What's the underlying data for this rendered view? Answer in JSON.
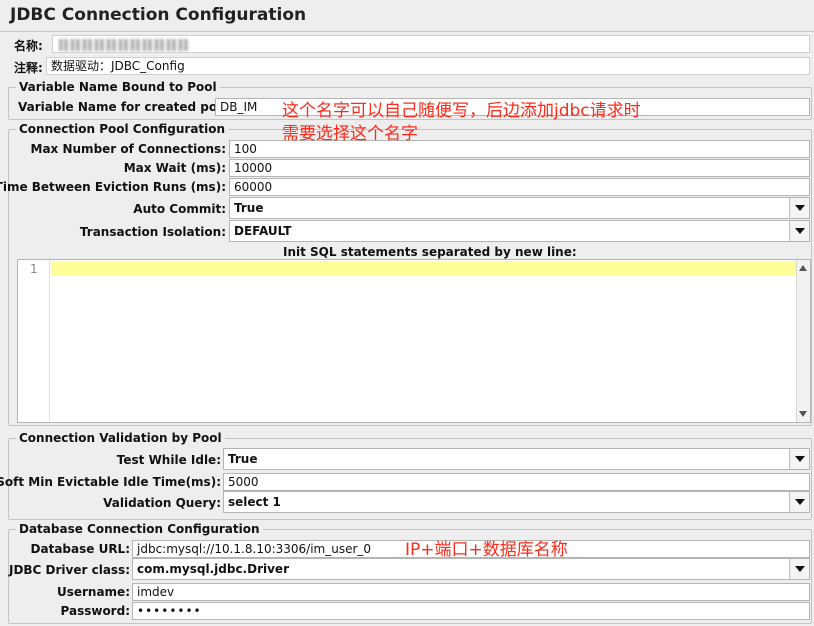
{
  "title": "JDBC Connection Configuration",
  "name_label": "名称:",
  "comment_label": "注释:",
  "comment_value": "数据驱动：JDBC_Config",
  "variable_group": {
    "legend": "Variable Name Bound to Pool",
    "label": "Variable Name for created pool:",
    "value": "DB_IM"
  },
  "annotation_1": {
    "line1": "这个名字可以自己随便写，后边添加jdbc请求时",
    "line2": "需要选择这个名字"
  },
  "pool_group": {
    "legend": "Connection Pool Configuration",
    "max_connections_label": "Max Number of Connections:",
    "max_connections_value": "100",
    "max_wait_label": "Max Wait (ms):",
    "max_wait_value": "10000",
    "eviction_label": "Time Between Eviction Runs (ms):",
    "eviction_value": "60000",
    "auto_commit_label": "Auto Commit:",
    "auto_commit_value": "True",
    "isolation_label": "Transaction Isolation:",
    "isolation_value": "DEFAULT",
    "init_sql_label": "Init SQL statements separated by new line:",
    "init_sql_line_number": "1"
  },
  "validation_group": {
    "legend": "Connection Validation by Pool",
    "test_idle_label": "Test While Idle:",
    "test_idle_value": "True",
    "soft_min_label": "Soft Min Evictable Idle Time(ms):",
    "soft_min_value": "5000",
    "query_label": "Validation Query:",
    "query_value": "select 1"
  },
  "db_group": {
    "legend": "Database Connection Configuration",
    "url_label": "Database URL:",
    "url_value": "jdbc:mysql://10.1.8.10:3306/im_user_0",
    "driver_label": "JDBC Driver class:",
    "driver_value": "com.mysql.jdbc.Driver",
    "username_label": "Username:",
    "username_value": "imdev",
    "password_label": "Password:",
    "password_value": "••••••••"
  },
  "annotation_2": "IP+端口+数据库名称",
  "colors": {
    "annotation": "#ff2a1a",
    "highlight_line": "#ffff99",
    "background": "#eeeeee"
  }
}
